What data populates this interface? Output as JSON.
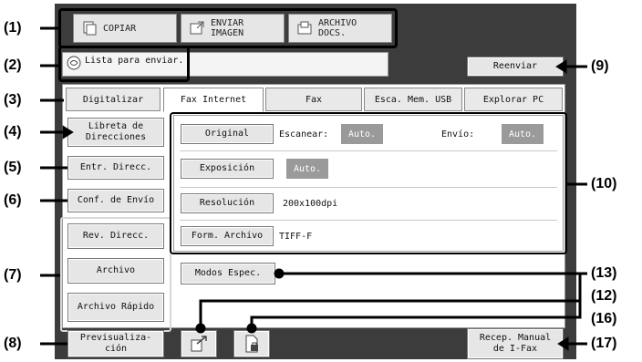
{
  "mode_buttons": [
    {
      "label": "COPIAR",
      "icon": "copy-icon"
    },
    {
      "label": "ENVIAR IMAGEN",
      "icon": "send-image-icon"
    },
    {
      "label": "ARCHIVO DOCS.",
      "icon": "document-filing-icon"
    }
  ],
  "status": {
    "message": "Lista para enviar.",
    "icon": "status-icon"
  },
  "resend_label": "Reenviar",
  "tabs": [
    "Digitalizar",
    "Fax Internet",
    "Fax",
    "Esca. Mem. USB",
    "Explorar PC"
  ],
  "active_tab": "Fax Internet",
  "left_buttons": {
    "address_book": "Libreta de Direcciones",
    "address_entry": "Entr. Direcc.",
    "send_settings": "Conf. de Envío",
    "address_review": "Rev. Direcc.",
    "file": "Archivo",
    "quick_file": "Archivo Rápido",
    "preview": "Previsualiza-ción"
  },
  "settings": {
    "original_label": "Original",
    "scan_label": "Escanear:",
    "scan_value": "Auto.",
    "send_label": "Envío:",
    "send_value": "Auto.",
    "exposure_label": "Exposición",
    "exposure_value": "Auto.",
    "resolution_label": "Resolución",
    "resolution_value": "200x100dpi",
    "file_format_label": "Form. Archivo",
    "file_format_value": "TIFF-F"
  },
  "special_modes_label": "Modos Espec.",
  "manual_receive_label": "Recep. Manual de I-Fax",
  "icon_buttons": [
    "send-arrow-icon",
    "document-receive-icon"
  ],
  "callouts": {
    "c1": "(1)",
    "c2": "(2)",
    "c3": "(3)",
    "c4": "(4)",
    "c5": "(5)",
    "c6": "(6)",
    "c7": "(7)",
    "c8": "(8)",
    "c9": "(9)",
    "c10": "(10)",
    "c12": "(12)",
    "c13": "(13)",
    "c16": "(16)",
    "c17": "(17)"
  }
}
